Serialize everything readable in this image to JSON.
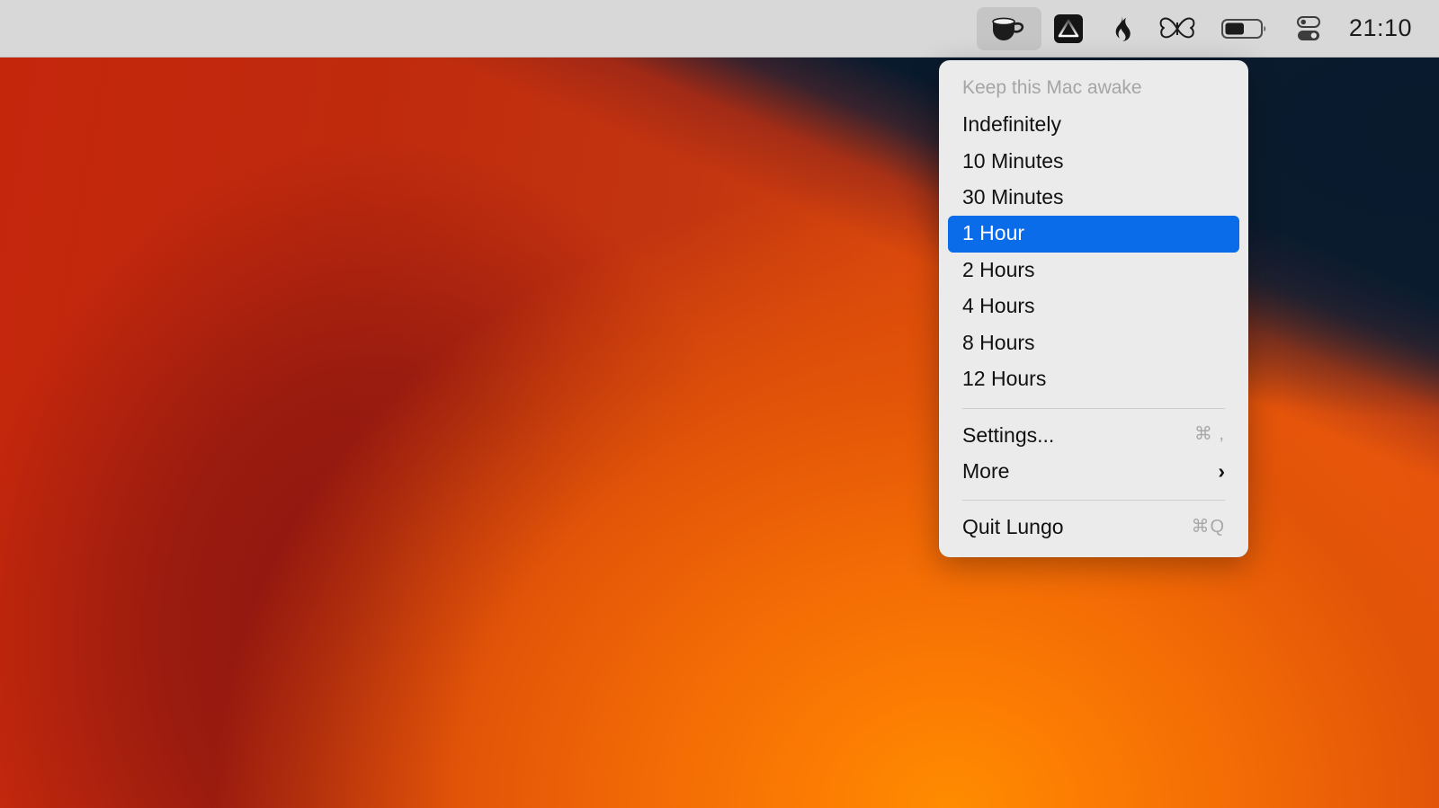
{
  "desktop": {
    "wallpaper_name": "big-sur-orange-gradient",
    "colors": {
      "orange": "#f07011",
      "red": "#c4260c",
      "dark_navy": "#0a1a2d"
    }
  },
  "menubar": {
    "background": "#d8d8d8",
    "clock": "21:10",
    "items": [
      {
        "name": "lungo-coffee-icon",
        "label": "Lungo",
        "active": true
      },
      {
        "name": "affinity-icon",
        "label": "Affinity",
        "active": false
      },
      {
        "name": "flame-icon",
        "label": "Flame",
        "active": false
      },
      {
        "name": "butterfly-icon",
        "label": "Butterfly",
        "active": false
      },
      {
        "name": "battery-icon",
        "label": "Battery",
        "active": false,
        "level_percent": 50
      },
      {
        "name": "control-center-icon",
        "label": "Control Center",
        "active": false
      }
    ]
  },
  "menu": {
    "accent_color": "#0a6ce8",
    "background": "#ebebeb",
    "header": "Keep this Mac awake",
    "durations": [
      {
        "label": "Indefinitely",
        "selected": false
      },
      {
        "label": "10 Minutes",
        "selected": false
      },
      {
        "label": "30 Minutes",
        "selected": false
      },
      {
        "label": "1 Hour",
        "selected": true
      },
      {
        "label": "2 Hours",
        "selected": false
      },
      {
        "label": "4 Hours",
        "selected": false
      },
      {
        "label": "8 Hours",
        "selected": false
      },
      {
        "label": "12 Hours",
        "selected": false
      }
    ],
    "actions": [
      {
        "label": "Settings...",
        "shortcut": "⌘ ,",
        "has_submenu": false
      },
      {
        "label": "More",
        "shortcut": "",
        "has_submenu": true,
        "submenu_arrow": "›"
      }
    ],
    "quit": {
      "label": "Quit Lungo",
      "shortcut": "⌘Q"
    }
  }
}
